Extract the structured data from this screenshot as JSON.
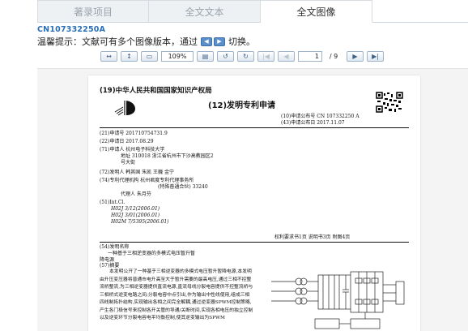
{
  "tabs": [
    {
      "label": "著录项目",
      "active": false
    },
    {
      "label": "全文文本",
      "active": false
    },
    {
      "label": "全文图像",
      "active": true
    }
  ],
  "doc_id": "CN107332250A",
  "tip": {
    "prefix": "温馨提示：文献可有多个图像版本，通过",
    "suffix": "切换。"
  },
  "toolbar": {
    "zoom": "109%",
    "page": "1",
    "total": "/ 9"
  },
  "doc": {
    "office": "(19)中华人民共和国国家知识产权局",
    "type": "(12)发明专利申请",
    "pub_no": "(10)申请公布号 CN 107332250 A",
    "pub_date": "(43)申请公布日 2017.11.07",
    "app_no": "(21)申请号 201710754731.9",
    "app_date": "(22)申请日 2017.08.29",
    "applicant": "(71)申请人 杭州电子科技大学",
    "address1": "地址 310018 浙江省杭州市下沙高教园区2",
    "address2": "号大街",
    "inventors": "(72)发明人 韩其国  朱凯  王巍  金宁",
    "agency1": "(74)专利代理机构 杭州君度专利代理事务所",
    "agency2": "(特殊普通合伙) 33240",
    "agent": "代理人 朱月芬",
    "intcl": "(51)Int.Cl.",
    "ipc1": "H02J 3/12(2006.01)",
    "ipc2": "H02J 3/01(2006.01)",
    "ipc3": "H02M 7/5395(2006.01)",
    "summary": "权利要求书1页  说明书3页  附图4页",
    "title_label": "(54)发明名称",
    "title_line1": "一种基于三相逆变器的多模式电压暂升暂",
    "title_line2": "降电源",
    "abstract_label": "(57)摘要",
    "abstract_text": "本发明公开了一种基于三相逆变器的多模式电压暂升暂降电源,本发明由升压变压器将普通市电升高至大于暂升需要的最高电压,通过三相不控整流桥整流,为三相逆变器提供直流电源,直流母线分裂电容提供不控整流桥与三相桥式逆变电路之间;分裂电容中点引出,作为输出中性线使用,组成三相四线制拓扑结构,实现输出各相之间完全解耦,通过逆变器SPWM控制策略,产生各门极信号来控制各开关管的导通/关断时间,实现各相电压的独立控制以及逆变环节分裂电容电平均衡控制,使其逆变输出为SPWM"
  }
}
